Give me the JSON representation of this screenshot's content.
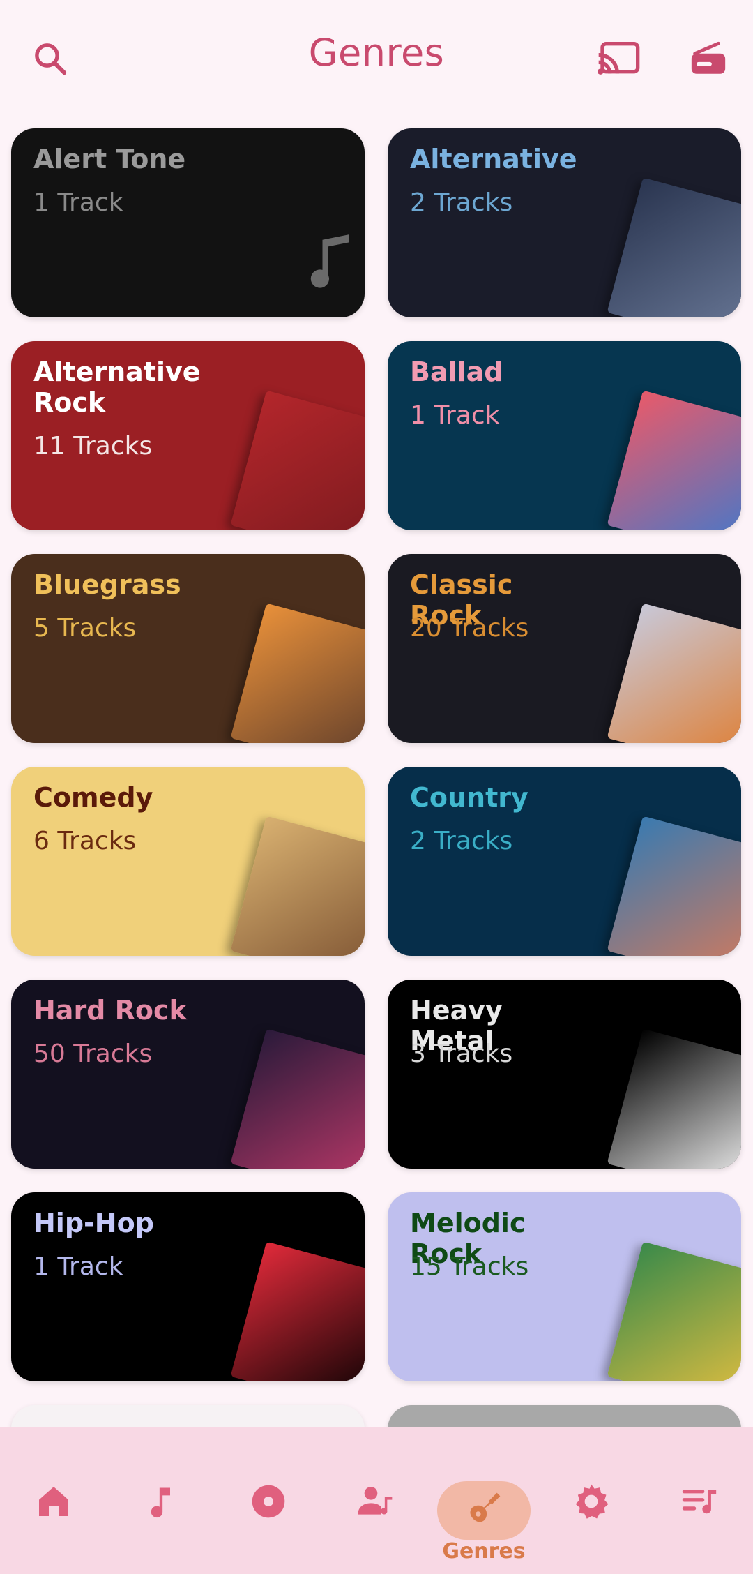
{
  "header": {
    "title": "Genres",
    "icons": [
      "search-icon",
      "cast-icon",
      "radio-icon"
    ],
    "accent": "#c94a6e"
  },
  "genres": [
    {
      "name": "Alert Tone",
      "count": "1 Track",
      "bg": "#121212",
      "fg": "#9a9a9a",
      "count_fg": "#8a8a8a",
      "art": "music-note-icon"
    },
    {
      "name": "Alternative",
      "count": "2 Tracks",
      "bg": "#1a1c2a",
      "fg": "#7ab2e0",
      "count_fg": "#6da7d2",
      "art": "album-art"
    },
    {
      "name": "Alternative Rock",
      "count": "11 Tracks",
      "bg": "#9b1f24",
      "fg": "#ffffff",
      "count_fg": "#f4e6e6",
      "art": "album-art"
    },
    {
      "name": "Ballad",
      "count": "1 Track",
      "bg": "#063650",
      "fg": "#f29bb2",
      "count_fg": "#f08fa8",
      "art": "album-art"
    },
    {
      "name": "Bluegrass",
      "count": "5 Tracks",
      "bg": "#4a2e1c",
      "fg": "#f0c05a",
      "count_fg": "#e8b850",
      "art": "album-art"
    },
    {
      "name": "Classic Rock",
      "count": "20 Tracks",
      "bg": "#1a1a22",
      "fg": "#e59a3a",
      "count_fg": "#d98e32",
      "art": "album-art"
    },
    {
      "name": "Comedy",
      "count": "6 Tracks",
      "bg": "#f0d07a",
      "fg": "#5a1a0a",
      "count_fg": "#6a2a10",
      "art": "album-art"
    },
    {
      "name": "Country",
      "count": "2 Tracks",
      "bg": "#062e4a",
      "fg": "#42b8d0",
      "count_fg": "#3aaec6",
      "art": "album-art"
    },
    {
      "name": "Hard Rock",
      "count": "50 Tracks",
      "bg": "#13101f",
      "fg": "#e48aa6",
      "count_fg": "#d87a96",
      "art": "album-art"
    },
    {
      "name": "Heavy Metal",
      "count": "3 Tracks",
      "bg": "#000000",
      "fg": "#e8e8e8",
      "count_fg": "#d8d8d8",
      "art": "album-art"
    },
    {
      "name": "Hip-Hop",
      "count": "1 Track",
      "bg": "#000000",
      "fg": "#c4c8f8",
      "count_fg": "#b4b8ec",
      "art": "album-art"
    },
    {
      "name": "Melodic Rock",
      "count": "15 Tracks",
      "bg": "#bfbfee",
      "fg": "#0f4a16",
      "count_fg": "#1a5a20",
      "art": "album-art"
    },
    {
      "name": "",
      "count": "",
      "bg": "#f6f2f4",
      "fg": "#c94a6e",
      "count_fg": "#c94a6e",
      "art": ""
    },
    {
      "name": "",
      "count": "",
      "bg": "#a8a8a8",
      "fg": "#c94a6e",
      "count_fg": "#c94a6e",
      "art": ""
    }
  ],
  "bottom_nav": {
    "items": [
      {
        "icon": "home-icon"
      },
      {
        "icon": "music-note-icon"
      },
      {
        "icon": "album-icon"
      },
      {
        "icon": "artist-icon"
      },
      {
        "icon": "guitar-icon",
        "label": "Genres",
        "active": true
      },
      {
        "icon": "gear-icon"
      },
      {
        "icon": "playlist-icon"
      }
    ],
    "active_color": "#d97a4a",
    "icon_color": "#e0607e"
  }
}
